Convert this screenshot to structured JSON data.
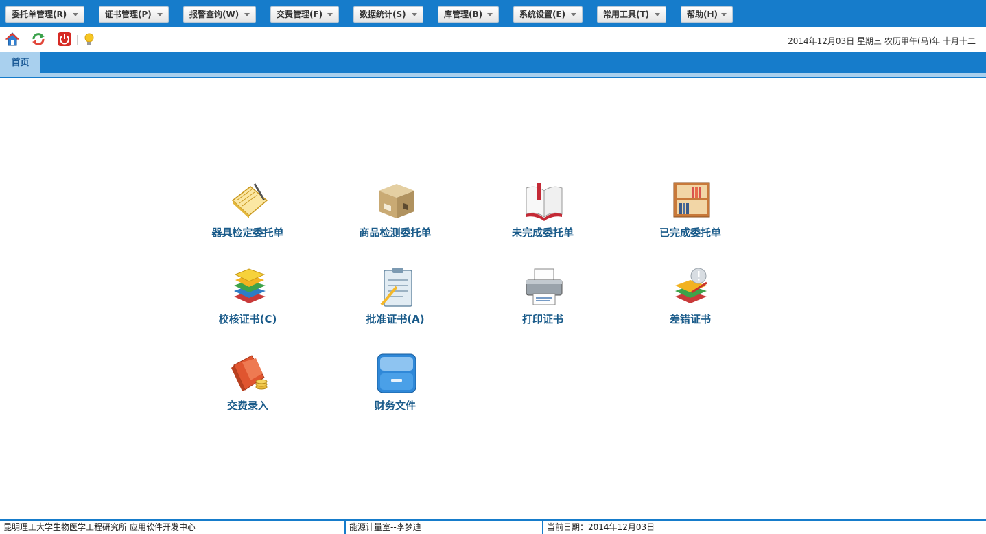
{
  "menu": [
    {
      "label": "委托单管理(R)"
    },
    {
      "label": "证书管理(P)"
    },
    {
      "label": "报警查询(W)"
    },
    {
      "label": "交费管理(F)"
    },
    {
      "label": "数据统计(S)"
    },
    {
      "label": "库管理(B)"
    },
    {
      "label": "系统设置(E)"
    },
    {
      "label": "常用工具(T)"
    },
    {
      "label": "帮助(H)"
    }
  ],
  "toolbar": {
    "icons": [
      "home-icon",
      "refresh-icon",
      "power-icon",
      "lightbulb-icon"
    ],
    "date_text": "2014年12月03日 星期三 农历甲午(马)年 十月十二"
  },
  "tabs": [
    {
      "label": "首页",
      "active": true
    }
  ],
  "tiles": [
    {
      "label": "器具检定委托单",
      "icon": "notebook-pen-icon"
    },
    {
      "label": "商品检测委托单",
      "icon": "cardboard-box-icon"
    },
    {
      "label": "未完成委托单",
      "icon": "open-book-icon"
    },
    {
      "label": "已完成委托单",
      "icon": "bookshelf-icon"
    },
    {
      "label": "校核证书(C)",
      "icon": "book-stack-icon"
    },
    {
      "label": "批准证书(A)",
      "icon": "clipboard-icon"
    },
    {
      "label": "打印证书",
      "icon": "printer-icon"
    },
    {
      "label": "差错证书",
      "icon": "books-alert-icon"
    },
    {
      "label": "交费录入",
      "icon": "wallet-coins-icon"
    },
    {
      "label": "财务文件",
      "icon": "file-drawer-icon"
    }
  ],
  "status": {
    "org": "昆明理工大学生物医学工程研究所 应用软件开发中心",
    "lab": "能源计量室--李梦迪",
    "current_date_label": "当前日期：",
    "current_date": "2014年12月03日"
  },
  "colors": {
    "brand_blue": "#167ccb",
    "tab_active": "#a9d0ee",
    "tile_label": "#1a5b8a"
  }
}
